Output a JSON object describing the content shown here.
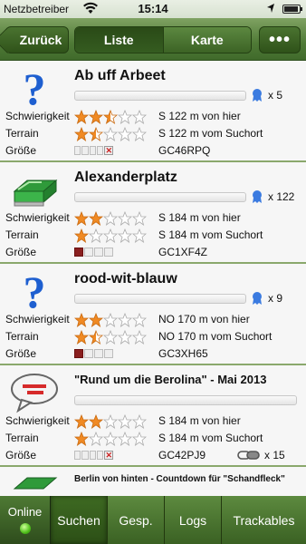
{
  "status": {
    "carrier": "Netzbetreiber",
    "time": "15:14"
  },
  "nav": {
    "back_label": "Zurück",
    "segments": [
      "Liste",
      "Karte"
    ],
    "more_label": "•••"
  },
  "labels": {
    "difficulty": "Schwierigkeit",
    "terrain": "Terrain",
    "size": "Größe"
  },
  "caches": [
    {
      "name": "Ab uff Arbeet",
      "icon": "question-mark-icon",
      "favorites": "x 5",
      "difficulty_stars": 2.5,
      "terrain_stars": 1.5,
      "difficulty_info": "S 122 m von hier",
      "terrain_info": "S 122 m vom Suchort",
      "code": "GC46RPQ",
      "size_level": 0,
      "size_unknown": true
    },
    {
      "name": "Alexanderplatz",
      "icon": "container-icon",
      "favorites": "x 122",
      "difficulty_stars": 2,
      "terrain_stars": 1,
      "difficulty_info": "S 184 m von hier",
      "terrain_info": "S 184 m vom Suchort",
      "code": "GC1XF4Z",
      "size_level": 1,
      "size_unknown": false
    },
    {
      "name": "rood-wit-blauw",
      "icon": "question-mark-icon",
      "favorites": "x 9",
      "difficulty_stars": 2,
      "terrain_stars": 1.5,
      "difficulty_info": "NO 170 m von hier",
      "terrain_info": "NO 170 m vom Suchort",
      "code": "GC3XH65",
      "size_level": 1,
      "size_unknown": false
    },
    {
      "name": "\"Rund um die Berolina\"  -  Mai  2013",
      "icon": "speech-bubble-icon",
      "favorites": "",
      "difficulty_stars": 2,
      "terrain_stars": 1,
      "difficulty_info": "S 184 m von hier",
      "terrain_info": "S 184 m vom Suchort",
      "code": "GC42PJ9",
      "size_level": 0,
      "size_unknown": true,
      "trackables": "x 15"
    }
  ],
  "partial_cache": {
    "name": "Berlin von hinten - Countdown für \"Schandfleck\""
  },
  "tabbar": {
    "online_label": "Online",
    "tabs": [
      "Suchen",
      "Gesp.",
      "Logs",
      "Trackables"
    ]
  },
  "colors": {
    "accent": "#4f7a36",
    "star": "#f08a24",
    "divider": "#8aa86c"
  }
}
